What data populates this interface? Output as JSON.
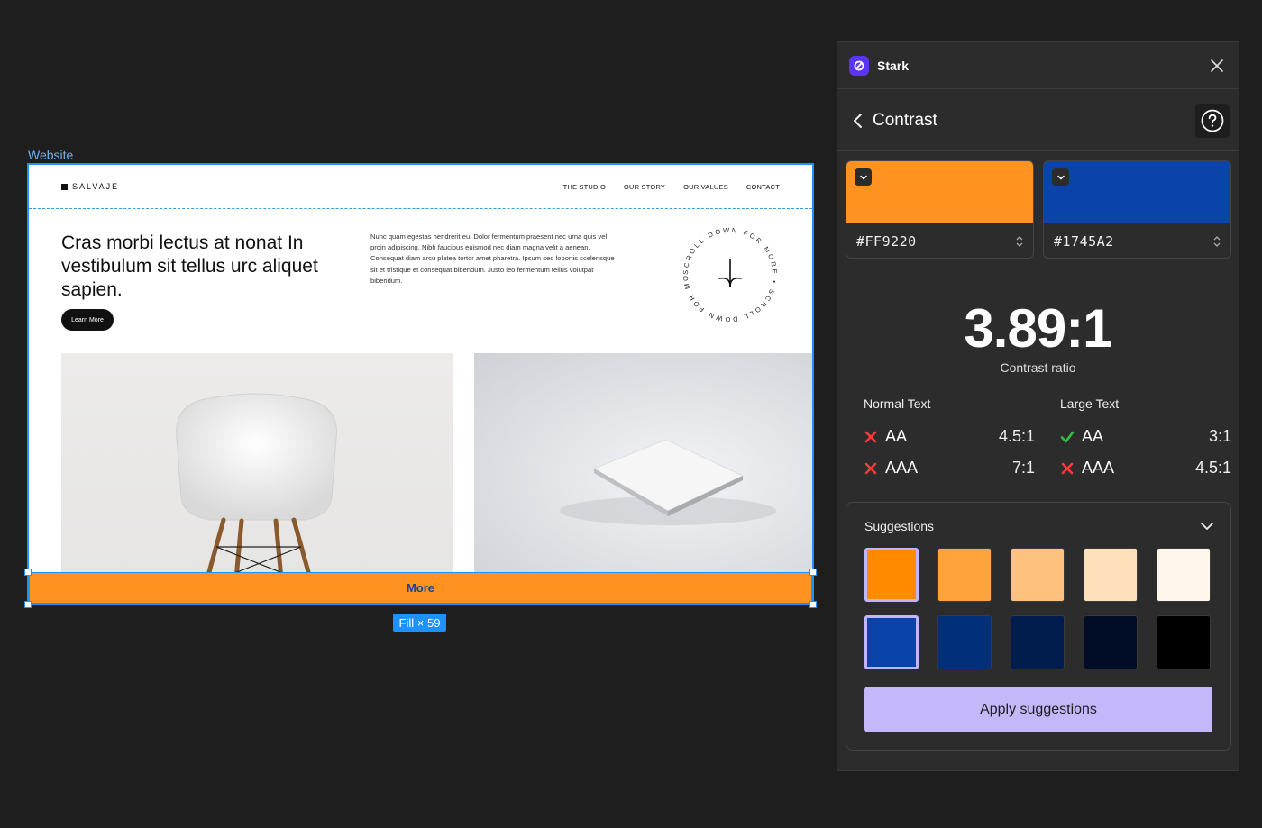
{
  "canvas": {
    "frame_label": "Website",
    "fill_tag": "Fill × 59"
  },
  "website": {
    "brand": "SALVAJE",
    "nav": [
      "THE STUDIO",
      "OUR STORY",
      "OUR VALUES",
      "CONTACT"
    ],
    "hero_title": "Cras morbi lectus at nonat In vestibulum sit tellus urc aliquet sapien.",
    "learn_more": "Learn More",
    "paragraph": "Nunc quam egestas hendrerit eu. Dolor fermentum praesent nec urna quis vel proin adipiscing. Nibh faucibus euismod nec diam magna velit a aenean. Consequat diam arcu platea tortor amet pharetra. Ipsum sed lobortis scelerisque sit et tristique et consequat bibendum. Justo leo fermentum tellus volutpat bibendum.",
    "scroll_text": "SCROLL DOWN FOR MORE • SCROLL DOWN FOR MORE • ",
    "more_button": "More"
  },
  "panel": {
    "app_name": "Stark",
    "subtitle": "Contrast",
    "foreground": {
      "hex_label": "#FF9220",
      "color": "#ff9220"
    },
    "background": {
      "hex_label": "#1745A2",
      "color": "#0a44a8"
    },
    "ratio": "3.89:1",
    "ratio_label": "Contrast ratio",
    "normal_text": {
      "title": "Normal Text",
      "rows": [
        {
          "level": "AA",
          "value": "4.5:1",
          "pass": false
        },
        {
          "level": "AAA",
          "value": "7:1",
          "pass": false
        }
      ]
    },
    "large_text": {
      "title": "Large Text",
      "rows": [
        {
          "level": "AA",
          "value": "3:1",
          "pass": true
        },
        {
          "level": "AAA",
          "value": "4.5:1",
          "pass": false
        }
      ]
    },
    "suggestions": {
      "title": "Suggestions",
      "row1": [
        "#ff8a00",
        "#ffa43a",
        "#ffc27e",
        "#ffe0bb",
        "#fff6ec"
      ],
      "row2": [
        "#0a44a8",
        "#022f7a",
        "#011d4e",
        "#010d26",
        "#000000"
      ],
      "apply_label": "Apply suggestions"
    },
    "colors": {
      "pass": "#2fbe4a",
      "fail": "#ff3b3b",
      "accent": "#5b36f2"
    }
  }
}
